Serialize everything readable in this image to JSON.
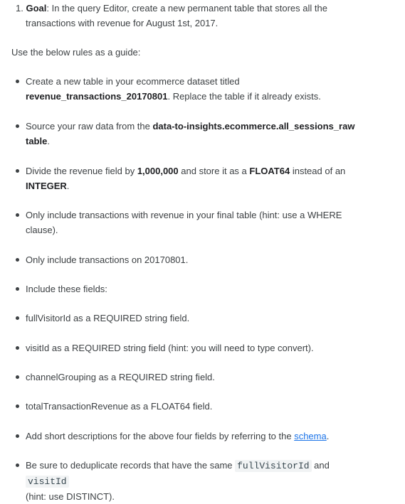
{
  "goal": {
    "number": "1.",
    "label": "Goal",
    "line1": ": In the query Editor, create a new permanent table that stores all the",
    "line2": "transactions with revenue for August 1st, 2017."
  },
  "intro": "Use the below rules as a guide:",
  "rules": {
    "r1": {
      "pre": "Create a new table in your ecommerce dataset titled",
      "bold": "revenue_transactions_20170801",
      "post": ". Replace the table if it already exists."
    },
    "r2": {
      "pre": "Source your raw data from the ",
      "bold1": "data-to-insights.ecommerce.all_sessions_raw",
      "bold2": "table",
      "post": "."
    },
    "r3": {
      "pre": "Divide the revenue field by ",
      "bold1": "1,000,000",
      "mid": " and store it as a ",
      "bold2": "FLOAT64",
      "mid2": " instead of an",
      "bold3": "INTEGER",
      "post": "."
    },
    "r4": {
      "line1": "Only include transactions with revenue in your final table (hint: use a WHERE",
      "line2": "clause)."
    },
    "r5": "Only include transactions on 20170801.",
    "r6": "Include these fields:",
    "r7": "fullVisitorId as a REQUIRED string field.",
    "r8": "visitId as a REQUIRED string field (hint: you will need to type convert).",
    "r9": "channelGrouping as a REQUIRED string field.",
    "r10": "totalTransactionRevenue as a FLOAT64 field.",
    "r11": {
      "pre": "Add short descriptions for the above four fields by referring to the ",
      "link": "schema",
      "post": "."
    },
    "r12": {
      "pre": "Be sure to deduplicate records that have the same ",
      "code1": "fullVisitorId",
      "mid": " and ",
      "code2": "visitId",
      "line2": "(hint: use DISTINCT)."
    }
  }
}
